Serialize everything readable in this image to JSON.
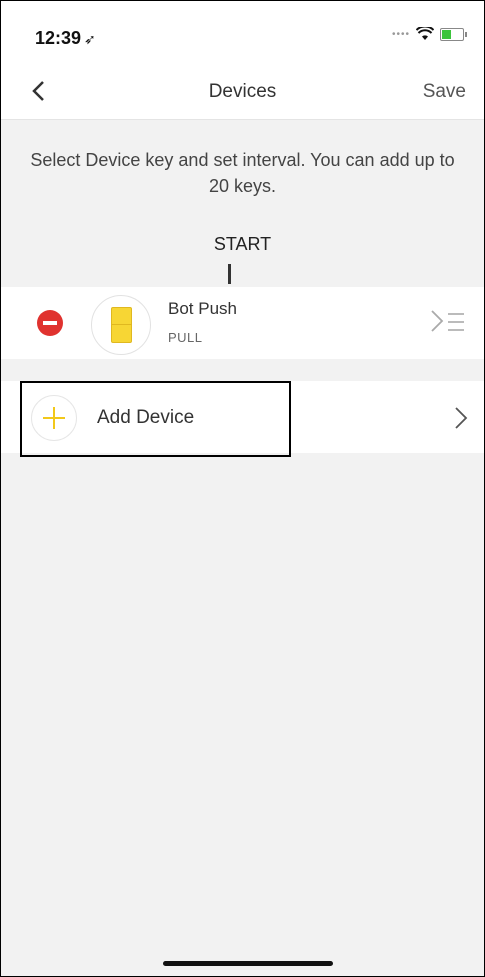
{
  "status_bar": {
    "time": "12:39",
    "location_icon": "location-arrow-icon",
    "signal_icon": "signal-dots-icon",
    "wifi_icon": "wifi-icon",
    "battery_icon": "battery-charging-icon",
    "battery_color": "#3cc43c"
  },
  "nav": {
    "back_icon": "chevron-left-icon",
    "title": "Devices",
    "save_label": "Save"
  },
  "description": "Select Device key and set interval. You can add up to 20 keys.",
  "start_label": "START",
  "devices": [
    {
      "name": "Bot Push",
      "mode": "PULL",
      "remove_icon": "remove-circle-icon",
      "device_icon": "switchbot-icon",
      "chevron_icon": "chevron-right-icon",
      "handle_icon": "drag-handle-icon"
    }
  ],
  "add_device": {
    "label": "Add Device",
    "icon": "plus-circle-icon",
    "chevron_icon": "chevron-right-icon",
    "accent_color": "#f2c81a"
  },
  "colors": {
    "remove": "#e0322f",
    "background": "#f2f2f2"
  }
}
